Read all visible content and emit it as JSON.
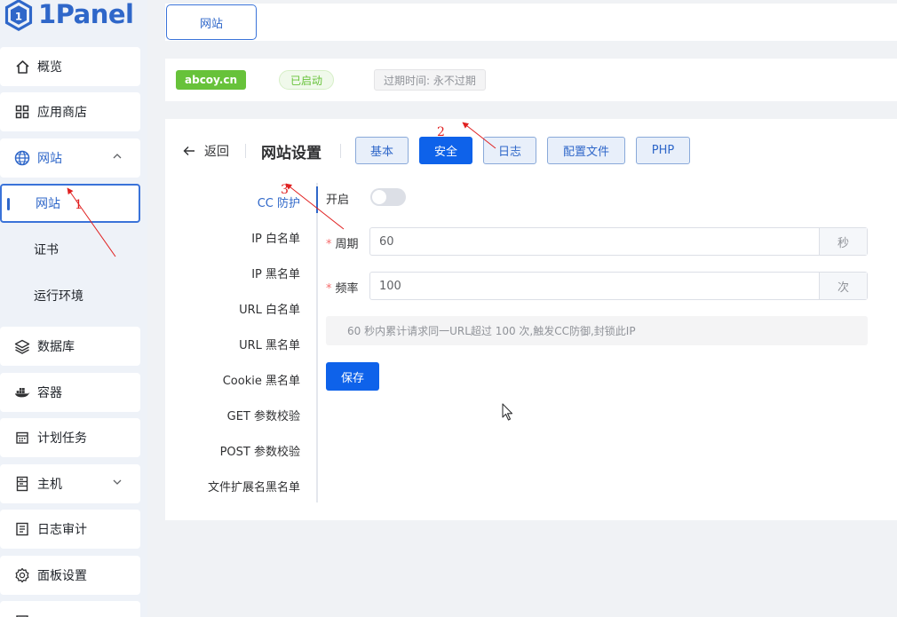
{
  "app": {
    "logo_text": "1Panel",
    "logo_number": "1"
  },
  "sidebar": {
    "items": [
      {
        "label": "概览",
        "icon": "home-icon"
      },
      {
        "label": "应用商店",
        "icon": "apps-grid-icon"
      },
      {
        "label": "网站",
        "icon": "globe-icon"
      },
      {
        "label": "网站",
        "icon": ""
      },
      {
        "label": "证书",
        "icon": ""
      },
      {
        "label": "运行环境",
        "icon": ""
      },
      {
        "label": "数据库",
        "icon": "layers-icon"
      },
      {
        "label": "容器",
        "icon": "docker-icon"
      },
      {
        "label": "计划任务",
        "icon": "calendar-icon"
      },
      {
        "label": "主机",
        "icon": "server-icon"
      },
      {
        "label": "日志审计",
        "icon": "log-icon"
      },
      {
        "label": "面板设置",
        "icon": "gear-icon"
      }
    ]
  },
  "tabs": {
    "active": "网站"
  },
  "site": {
    "domain": "abcoy.cn",
    "status": "已启动",
    "expire": "过期时间: 永不过期"
  },
  "card": {
    "back_label": "返回",
    "title": "网站设置",
    "top_buttons": [
      "基本",
      "安全",
      "日志",
      "配置文件",
      "PHP"
    ],
    "active_button": "安全"
  },
  "menu": {
    "items": [
      "CC 防护",
      "IP 白名单",
      "IP 黑名单",
      "URL 白名单",
      "URL 黑名单",
      "Cookie 黑名单",
      "GET 参数校验",
      "POST 参数校验",
      "文件扩展名黑名单"
    ],
    "active": "CC 防护"
  },
  "form": {
    "enable_label": "开启",
    "enabled": false,
    "period_label": "周期",
    "period_value": "60",
    "period_unit": "秒",
    "frequency_label": "频率",
    "frequency_value": "100",
    "frequency_unit": "次",
    "hint": "60 秒内累计请求同一URL超过 100 次,触发CC防御,封锁此IP",
    "save_label": "保存"
  },
  "annotations": {
    "n1": "1",
    "n2": "2",
    "n3": "3",
    "color": "#e02020"
  },
  "colors": {
    "primary": "#0e62ea",
    "accent": "#2f67c9",
    "success": "#67c23a"
  }
}
